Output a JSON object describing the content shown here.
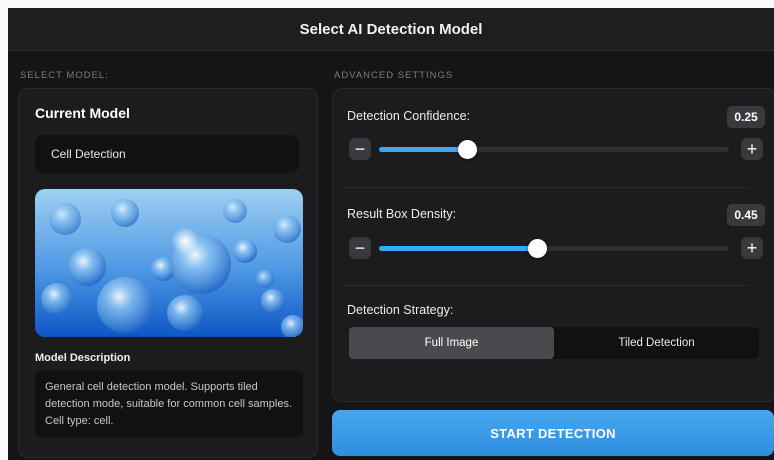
{
  "header": {
    "title": "Select AI Detection Model"
  },
  "left": {
    "section_label": "SELECT MODEL:",
    "current_title": "Current Model",
    "model_value": "Cell Detection",
    "description_title": "Model Description",
    "description": "General cell detection model. Supports tiled detection mode, suitable for common cell samples. Cell type: cell."
  },
  "right": {
    "section_label": "ADVANCED SETTINGS",
    "confidence": {
      "label": "Detection Confidence:",
      "value": "0.25",
      "fraction": 0.25
    },
    "density": {
      "label": "Result Box Density:",
      "value": "0.45",
      "fraction": 0.45
    },
    "strategy": {
      "label": "Detection Strategy:",
      "options": [
        "Full Image",
        "Tiled Detection"
      ],
      "selected": "Full Image"
    },
    "minus_symbol": "−",
    "plus_symbol": "+"
  },
  "start_label": "START DETECTION",
  "colors": {
    "accent": "#3aa9ee",
    "background": "#151517",
    "button": "#2d8ee0"
  },
  "icons": {
    "minus": "minus-icon",
    "plus": "plus-icon"
  }
}
